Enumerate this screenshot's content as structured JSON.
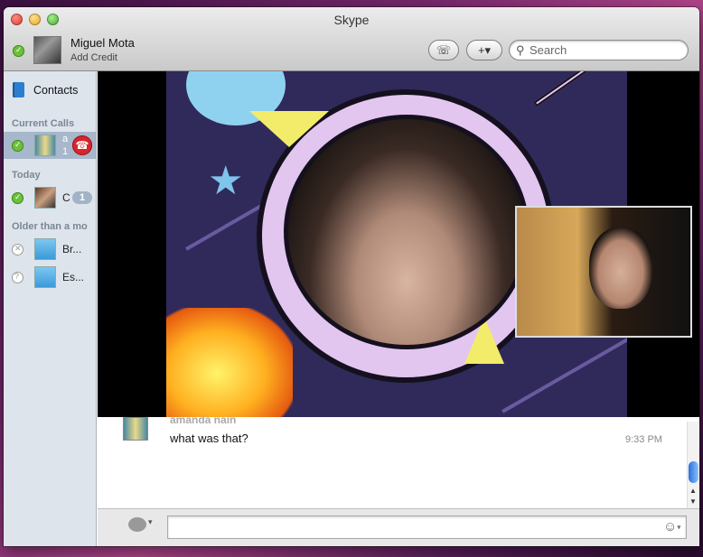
{
  "window": {
    "title": "Skype"
  },
  "user": {
    "name": "Miguel Mota",
    "credit_label": "Add Credit",
    "status": "online"
  },
  "toolbar": {
    "dialpad_icon": "☏",
    "add_icon": "+▾",
    "search_placeholder": "Search"
  },
  "sidebar": {
    "contacts_label": "Contacts",
    "sections": {
      "current_calls": "Current Calls",
      "today": "Today",
      "older": "Older than a mo"
    },
    "current_call": {
      "name": "a",
      "count": "1"
    },
    "today_item": {
      "name": "C",
      "badge": "1"
    },
    "older_items": [
      {
        "name": "Br...",
        "status": "offline"
      },
      {
        "name": "Es...",
        "status": "unknown"
      }
    ]
  },
  "chat": {
    "sender": "amanda nain",
    "message": "what was that?",
    "time": "9:33 PM"
  },
  "composer": {
    "value": ""
  },
  "colors": {
    "online": "#6dc13a",
    "hangup": "#d8252b",
    "selection": "#a7b7cc"
  }
}
